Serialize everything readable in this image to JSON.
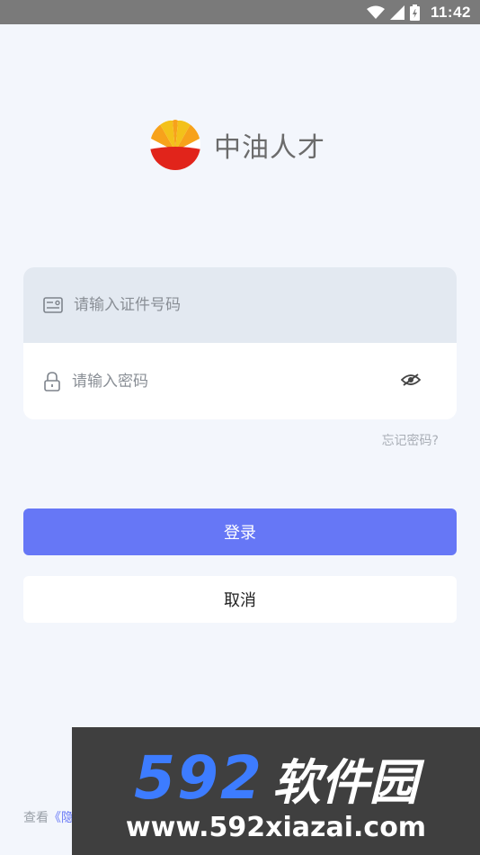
{
  "status_bar": {
    "time": "11:42"
  },
  "app": {
    "name": "中油人才"
  },
  "login_form": {
    "id_placeholder": "请输入证件号码",
    "password_placeholder": "请输入密码",
    "forgot_password": "忘记密码?"
  },
  "buttons": {
    "login": "登录",
    "cancel": "取消"
  },
  "footer": {
    "prefix": "查看",
    "link_visible": "《隐"
  },
  "watermark": {
    "number": "592",
    "name": "软件园",
    "url": "www.592xiazai.com"
  },
  "colors": {
    "accent": "#6677f6",
    "background": "#f3f6fc",
    "input_highlight": "#e3e9f1"
  },
  "icons": {
    "wifi": "wifi-icon",
    "signal": "signal-icon",
    "battery": "battery-icon",
    "id_card": "id-card-icon",
    "lock": "lock-icon",
    "eye": "eye-hidden-icon",
    "logo": "petrochina-logo"
  }
}
